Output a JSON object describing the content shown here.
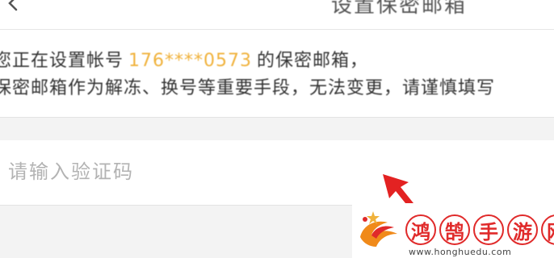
{
  "nav": {
    "back_icon": "chevron-left-icon",
    "title": "设置保密邮箱"
  },
  "info": {
    "line1_prefix": "您正在设置帐号",
    "account": "176****0573",
    "line1_suffix": "的保密邮箱，",
    "line2": "保密邮箱作为解冻、换号等重要手段，无法变更，请谨慎填写"
  },
  "verification": {
    "placeholder": "请输入验证码",
    "value": ""
  },
  "overlay": {
    "pointer": "red-arrow-icon"
  },
  "watermark": {
    "logo": "phoenix-logo",
    "chars": [
      "鸿",
      "鹄",
      "手",
      "游",
      "网"
    ],
    "url": "www.honghuedu.com"
  },
  "colors": {
    "account_highlight": "#f0b23c",
    "arrow": "#e32222",
    "watermark": "#e02a2a",
    "background": "#f3f3f3"
  }
}
